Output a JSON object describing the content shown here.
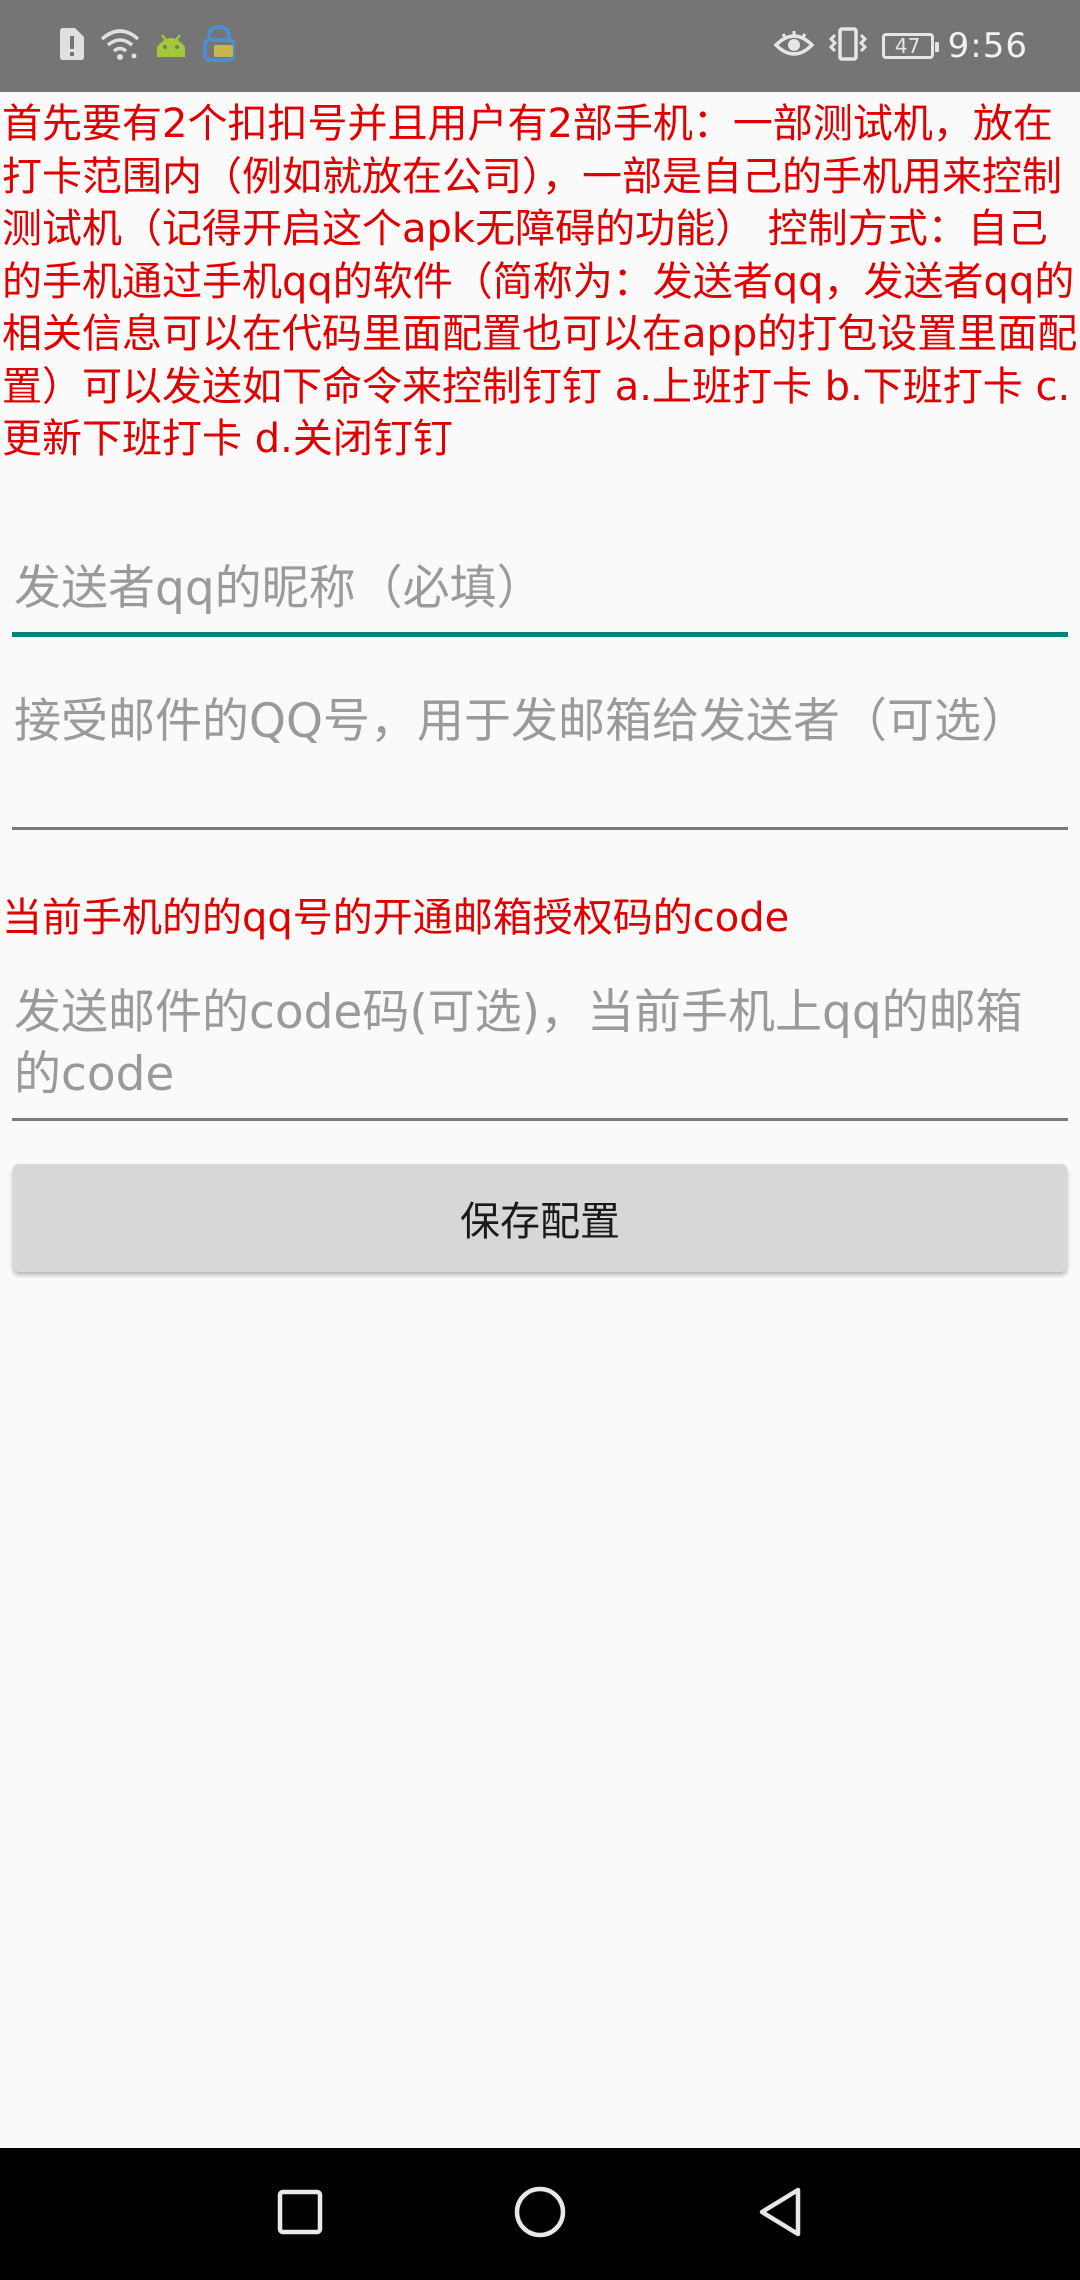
{
  "status_bar": {
    "time": "9:56",
    "battery_level": "47",
    "left_icons": [
      "alert-icon",
      "wifi-icon",
      "android-icon",
      "vpn-lock-icon"
    ],
    "right_icons": [
      "eye-icon",
      "vibrate-icon",
      "battery-icon"
    ]
  },
  "instructions": "首先要有2个扣扣号并且用户有2部手机：一部测试机，放在打卡范围内（例如就放在公司），一部是自己的手机用来控制测试机（记得开启这个apk无障碍的功能） 控制方式：自己的手机通过手机qq的软件（简称为：发送者qq，发送者qq的相关信息可以在代码里面配置也可以在app的打包设置里面配置）可以发送如下命令来控制钉钉 a.上班打卡 b.下班打卡 c.更新下班打卡 d.关闭钉钉",
  "fields": {
    "sender_nickname": {
      "placeholder": "发送者qq的昵称（必填）",
      "value": ""
    },
    "receiver_qq": {
      "placeholder": "接受邮件的QQ号，用于发邮箱给发送者（可选）",
      "value": ""
    },
    "code_label": "当前手机的的qq号的开通邮箱授权码的code",
    "email_code": {
      "placeholder": "发送邮件的code码(可选)，当前手机上qq的邮箱的code",
      "value": ""
    }
  },
  "save_button": "保存配置",
  "colors": {
    "accent": "#008577",
    "instruction_text": "#e00000",
    "status_bar": "#757575",
    "background": "#fafafa",
    "button": "#d6d7d7"
  },
  "nav_bar": [
    "recents-square-icon",
    "home-circle-icon",
    "back-triangle-icon"
  ]
}
